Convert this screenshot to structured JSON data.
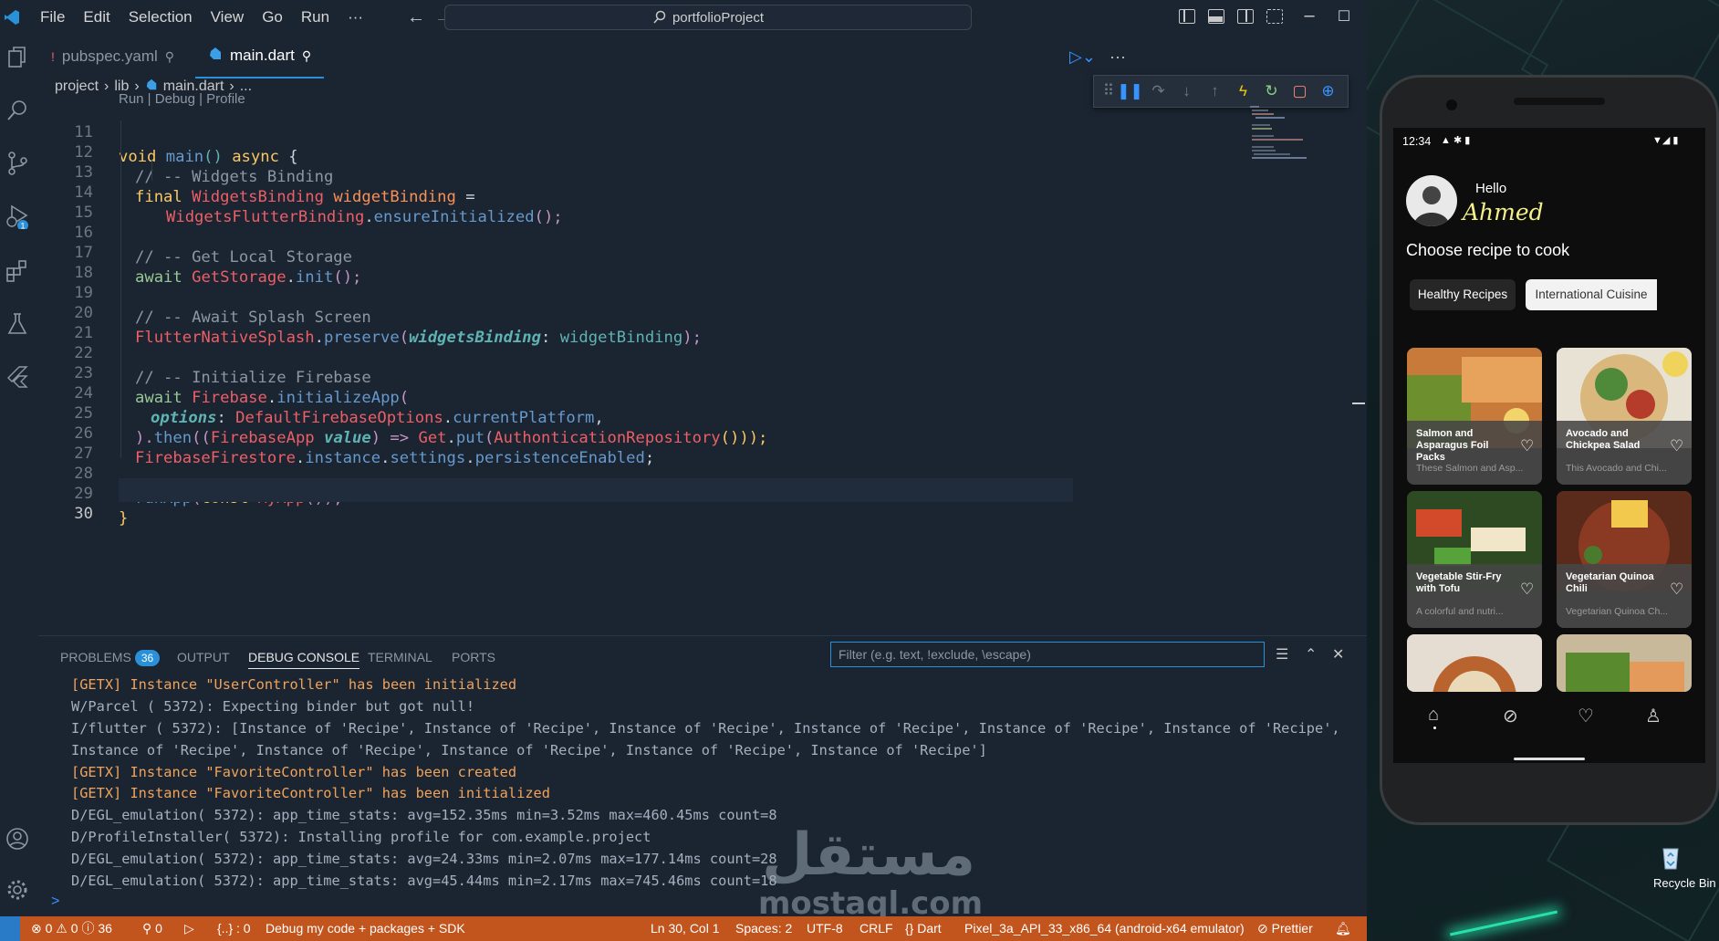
{
  "menu": [
    "File",
    "Edit",
    "Selection",
    "View",
    "Go",
    "Run",
    "···"
  ],
  "command_center": "portfolioProject",
  "tabs": [
    {
      "label": "pubspec.yaml",
      "active": false
    },
    {
      "label": "main.dart",
      "active": true
    }
  ],
  "breadcrumb": [
    "project",
    "lib",
    "main.dart",
    "..."
  ],
  "codelens": "Run | Debug | Profile",
  "code": {
    "numbers": [
      "11",
      "12",
      "13",
      "14",
      "15",
      "16",
      "17",
      "18",
      "19",
      "20",
      "21",
      "22",
      "23",
      "24",
      "25",
      "26",
      "27",
      "28",
      "29",
      "30"
    ],
    "l11": {
      "a": "void ",
      "b": "main",
      "c": "() ",
      "d": "async",
      "e": " {"
    },
    "l12": "// -- Widgets Binding",
    "l13": {
      "a": "final ",
      "b": "WidgetsBinding",
      "c": " widgetBinding",
      "d": " ="
    },
    "l14": {
      "a": "WidgetsFlutterBinding",
      "b": ".",
      "c": "ensureInitialized",
      "d": "();"
    },
    "l16": "// -- Get Local Storage",
    "l17": {
      "a": "await ",
      "b": "GetStorage",
      "c": ".",
      "d": "init",
      "e": "();"
    },
    "l19": "// -- Await Splash Screen",
    "l20": {
      "a": "FlutterNativeSplash",
      "b": ".",
      "c": "preserve",
      "d": "(",
      "e": "widgetsBinding",
      "f": ": ",
      "g": "widgetBinding",
      "h": ");"
    },
    "l22": "// -- Initialize Firebase",
    "l23": {
      "a": "await ",
      "b": "Firebase",
      "c": ".",
      "d": "initializeApp",
      "e": "("
    },
    "l24": {
      "a": "options",
      "b": ": ",
      "c": "DefaultFirebaseOptions",
      "d": ".",
      "e": "currentPlatform",
      "f": ","
    },
    "l25": {
      "a": ").",
      "b": "then",
      "c": "((",
      "d": "FirebaseApp",
      "e": " value",
      "f": ") => ",
      "g": "Get",
      "h": ".",
      "i": "put",
      "j": "(",
      "k": "AuthonticationRepository",
      "l": "()));"
    },
    "l26": {
      "a": "FirebaseFirestore",
      "b": ".",
      "c": "instance",
      "d": ".",
      "e": "settings",
      "f": ".",
      "g": "persistenceEnabled",
      "h": ";"
    },
    "l28": {
      "a": "runApp",
      "b": "(",
      "c": "const ",
      "d": "MyApp",
      "e": "());"
    },
    "l29": "}"
  },
  "panel": {
    "tabs": [
      {
        "label": "PROBLEMS",
        "badge": "36"
      },
      {
        "label": "OUTPUT"
      },
      {
        "label": "DEBUG CONSOLE",
        "active": true
      },
      {
        "label": "TERMINAL"
      },
      {
        "label": "PORTS"
      }
    ],
    "filter_placeholder": "Filter (e.g. text, !exclude, \\escape)",
    "console": [
      {
        "text": "[GETX] Instance \"UserController\" has been initialized",
        "color": "orange"
      },
      {
        "text": "W/Parcel  ( 5372): Expecting binder but got null!",
        "color": "normal"
      },
      {
        "text": "I/flutter ( 5372): [Instance of 'Recipe', Instance of 'Recipe', Instance of 'Recipe', Instance of 'Recipe', Instance of 'Recipe', Instance of 'Recipe',",
        "color": "normal"
      },
      {
        "text": "Instance of 'Recipe', Instance of 'Recipe', Instance of 'Recipe', Instance of 'Recipe', Instance of 'Recipe']",
        "color": "normal"
      },
      {
        "text": "[GETX] Instance \"FavoriteController\" has been created",
        "color": "orange"
      },
      {
        "text": "[GETX] Instance \"FavoriteController\" has been initialized",
        "color": "orange"
      },
      {
        "text": "D/EGL_emulation( 5372): app_time_stats: avg=152.35ms min=3.52ms max=460.45ms count=8",
        "color": "normal"
      },
      {
        "text": "D/ProfileInstaller( 5372): Installing profile for com.example.project",
        "color": "normal"
      },
      {
        "text": "D/EGL_emulation( 5372): app_time_stats: avg=24.33ms min=2.07ms max=177.14ms count=28",
        "color": "normal"
      },
      {
        "text": "D/EGL_emulation( 5372): app_time_stats: avg=45.44ms min=2.17ms max=745.46ms count=18",
        "color": "normal"
      }
    ],
    "prompt": ">"
  },
  "statusbar": {
    "errors": "0",
    "warnings": "0",
    "info": "36",
    "ports": "0",
    "braces": "{..} : 0",
    "debug_target": "Debug my code + packages + SDK",
    "position": "Ln 30, Col 1",
    "spaces": "Spaces: 2",
    "encoding": "UTF-8",
    "eol": "CRLF",
    "language": "Dart",
    "device": "Pixel_3a_API_33_x86_64 (android-x64 emulator)",
    "prettier": "Prettier"
  },
  "watermark": {
    "arabic": "مستقل",
    "latin": "mostaql.com"
  },
  "phone": {
    "time": "12:34",
    "greeting": "Hello",
    "name": "Ahmed",
    "heading": "Choose recipe to cook",
    "chips": [
      "Healthy Recipes",
      "International Cuisine"
    ],
    "recipes": [
      {
        "title": "Salmon and Asparagus Foil Packs",
        "desc": "These Salmon and Asp..."
      },
      {
        "title": "Avocado and Chickpea Salad",
        "desc": "This Avocado and Chi..."
      },
      {
        "title": "Vegetable Stir-Fry with Tofu",
        "desc": "A colorful and nutri..."
      },
      {
        "title": "Vegetarian Quinoa Chili",
        "desc": "Vegetarian Quinoa Ch..."
      }
    ]
  },
  "desktop": {
    "recycle_bin": "Recycle Bin"
  },
  "colors": {
    "accent": "#2a91d9",
    "statusbar": "#c2541d",
    "comment": "#8d97a3",
    "keyword": "#fac863",
    "function": "#6699cc"
  }
}
